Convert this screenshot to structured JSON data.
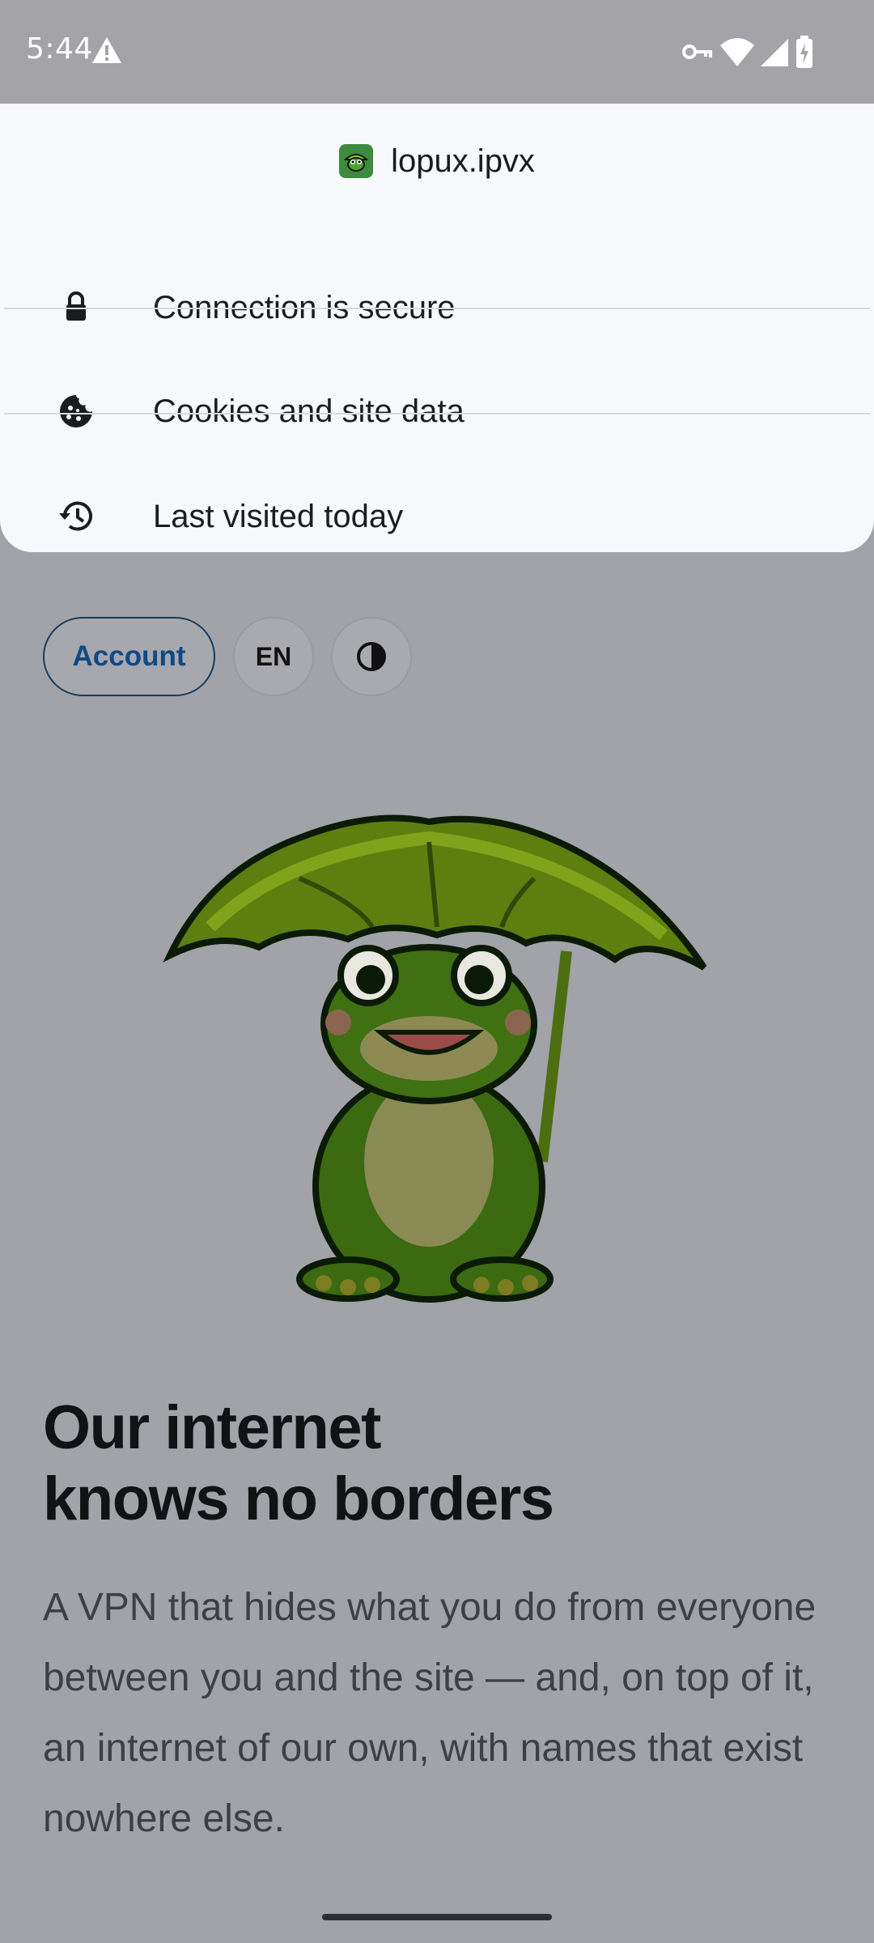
{
  "status_bar": {
    "time": "5:44",
    "icons": [
      "warning-icon",
      "vpn-key-icon",
      "wifi-icon",
      "signal-icon",
      "battery-charging-icon"
    ]
  },
  "site_info": {
    "favicon": "frog-favicon-icon",
    "domain": "lopux.ipvx",
    "rows": [
      {
        "icon": "lock-icon",
        "label": "Connection is secure"
      },
      {
        "icon": "cookie-icon",
        "label": "Cookies and site data"
      },
      {
        "icon": "history-icon",
        "label": "Last visited today"
      }
    ]
  },
  "page": {
    "account_label": "Account",
    "language_label": "EN",
    "theme_toggle_icon": "contrast-icon",
    "hero_image": "frog-with-leaf-umbrella",
    "headline_line1": "Our internet",
    "headline_line2": "knows no borders",
    "lead": "A VPN that hides what you do from everyone between you and the site — and, on top of it, an internet of our own, with names that exist nowhere else."
  },
  "colors": {
    "sheet_bg": "#f7f8fc",
    "scrim_bg": "#a1a3a8",
    "account_text": "#0f4a86"
  }
}
